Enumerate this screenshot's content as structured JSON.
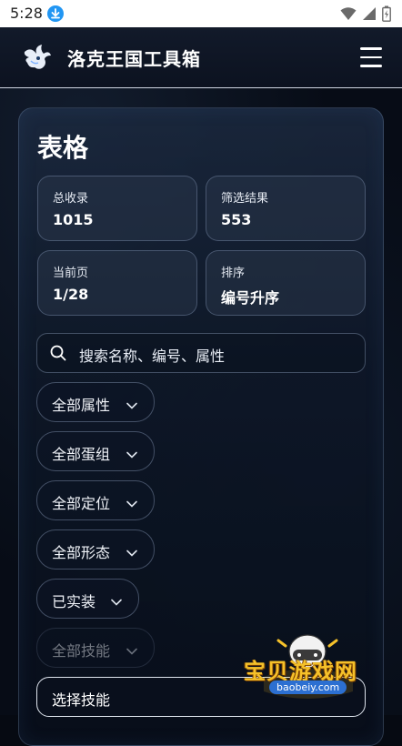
{
  "status_bar": {
    "time": "5:28"
  },
  "header": {
    "title": "洛克王国工具箱"
  },
  "page": {
    "title": "表格"
  },
  "stats": [
    {
      "label": "总收录",
      "value": "1015"
    },
    {
      "label": "筛选结果",
      "value": "553"
    },
    {
      "label": "当前页",
      "value": "1/28"
    },
    {
      "label": "排序",
      "value": "编号升序"
    }
  ],
  "search": {
    "placeholder": "搜索名称、编号、属性"
  },
  "filters": [
    {
      "label": "全部属性",
      "disabled": false
    },
    {
      "label": "全部蛋组",
      "disabled": false
    },
    {
      "label": "全部定位",
      "disabled": false
    },
    {
      "label": "全部形态",
      "disabled": false
    },
    {
      "label": "已实装",
      "disabled": false
    },
    {
      "label": "全部技能",
      "disabled": true
    }
  ],
  "skill_select": {
    "label": "选择技能"
  },
  "watermark": {
    "text": "宝贝游戏网",
    "url": "baobeiy.com"
  },
  "colors": {
    "accent_blue": "#2196f3",
    "watermark_gold": "#f5c12a",
    "background": "#070c16"
  }
}
